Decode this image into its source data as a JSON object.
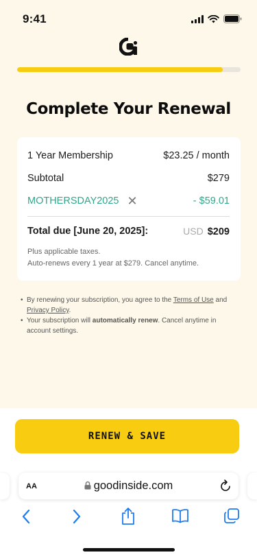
{
  "status_bar": {
    "time": "9:41"
  },
  "progress": {
    "fraction": 0.92,
    "color": "#f8cc10"
  },
  "page": {
    "title": "Complete Your Renewal"
  },
  "summary": {
    "membership_label": "1 Year Membership",
    "membership_price": "$23.25 / month",
    "subtotal_label": "Subtotal",
    "subtotal_value": "$279",
    "promo_code": "MOTHERSDAY2025",
    "promo_discount": "- $59.01",
    "total_label": "Total due [June 20, 2025]:",
    "total_currency": "USD",
    "total_amount": "$209",
    "note_line1": "Plus applicable taxes.",
    "note_line2": "Auto-renews every 1 year at $279. Cancel anytime."
  },
  "legal": {
    "line1_prefix": "By renewing your subscription, you agree to the ",
    "terms_link": "Terms of Use",
    "line1_mid": " and ",
    "privacy_link": "Privacy Policy",
    "line1_suffix": ".",
    "line2_prefix": "Your subscription will ",
    "line2_bold": "automatically renew",
    "line2_suffix": ". Cancel anytime in account settings."
  },
  "cta": {
    "label": "RENEW & SAVE"
  },
  "browser": {
    "aa_label": "AA",
    "url": "goodinside.com"
  },
  "colors": {
    "accent": "#f8cc10",
    "promo": "#2fa78a",
    "background": "#fdf8ea",
    "ios_blue": "#1a7cf0"
  },
  "icons": {
    "logo": "goodinside-logo",
    "lock": "lock-icon",
    "reload": "reload-icon",
    "back": "chevron-left-icon",
    "forward": "chevron-right-icon",
    "share": "share-icon",
    "bookmarks": "book-icon",
    "tabs": "tabs-icon"
  }
}
